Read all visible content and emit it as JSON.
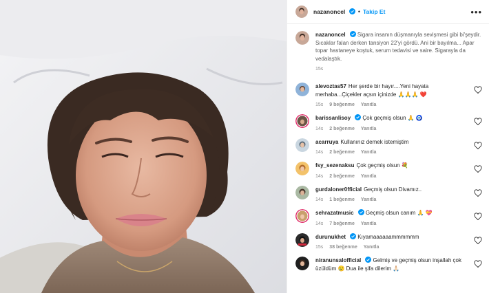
{
  "post": {
    "username": "nazanoncel",
    "follow_label": "Takip Et",
    "more_label": "•••",
    "caption": "Sigara insanın düşmanıyla sevişmesi gibi bi'şeydir. Sıcaklar falan derken tansiyon 22'yi gördü. Ani bir bayılma... Apar topar hastaneye koştuk, serum tedavisi ve saire. Sigarayla da vedalaştık.",
    "caption_time": "15s"
  },
  "comments": [
    {
      "username": "alevoztas57",
      "verified": false,
      "text": "Her şerde bir hayır....Yeni hayata merhaba...Çiçekler açsın içinizde 🙏🙏🙏 ❤️",
      "time": "15s",
      "likes": "9 beğenme",
      "reply": "Yanıtla"
    },
    {
      "username": "barissanlisoy",
      "verified": true,
      "text": "Çok geçmiş olsun 🙏 🧿",
      "time": "14s",
      "likes": "2 beğenme",
      "reply": "Yanıtla"
    },
    {
      "username": "acarruya",
      "verified": false,
      "text": "Kullanınız demek istemiştim",
      "time": "14s",
      "likes": "2 beğenme",
      "reply": "Yanıtla"
    },
    {
      "username": "fsy_sezenaksu",
      "verified": false,
      "text": "Çok geçmiş olsun 💐",
      "time": "14s",
      "likes": "2 beğenme",
      "reply": "Yanıtla"
    },
    {
      "username": "gurdaloner0fficial",
      "verified": false,
      "text": "Geçmiş olsun Divamız..",
      "time": "14s",
      "likes": "1 beğenme",
      "reply": "Yanıtla"
    },
    {
      "username": "sehrazatmusic",
      "verified": true,
      "text": "Geçmiş olsun canım 🙏 💝",
      "time": "14s",
      "likes": "7 beğenme",
      "reply": "Yanıtla"
    },
    {
      "username": "durunukhet",
      "verified": true,
      "text": "Kıyamaaaaaammmmmm",
      "time": "15s",
      "likes": "38 beğenme",
      "reply": "Yanıtla"
    },
    {
      "username": "niranunsalofficial",
      "verified": true,
      "text": "Gelmiş ve geçmiş olsun inşallah çok üzüldüm 😢 Dua ile şifa dilerim 🙏🏻",
      "time": "",
      "likes": "",
      "reply": ""
    }
  ],
  "colors": {
    "accent": "#0095f6",
    "heart": "#e0245e",
    "muted": "#8e8e8e"
  },
  "icons": {
    "verified": "verified-badge-icon",
    "heart": "heart-outline-icon",
    "more": "more-options-icon"
  }
}
